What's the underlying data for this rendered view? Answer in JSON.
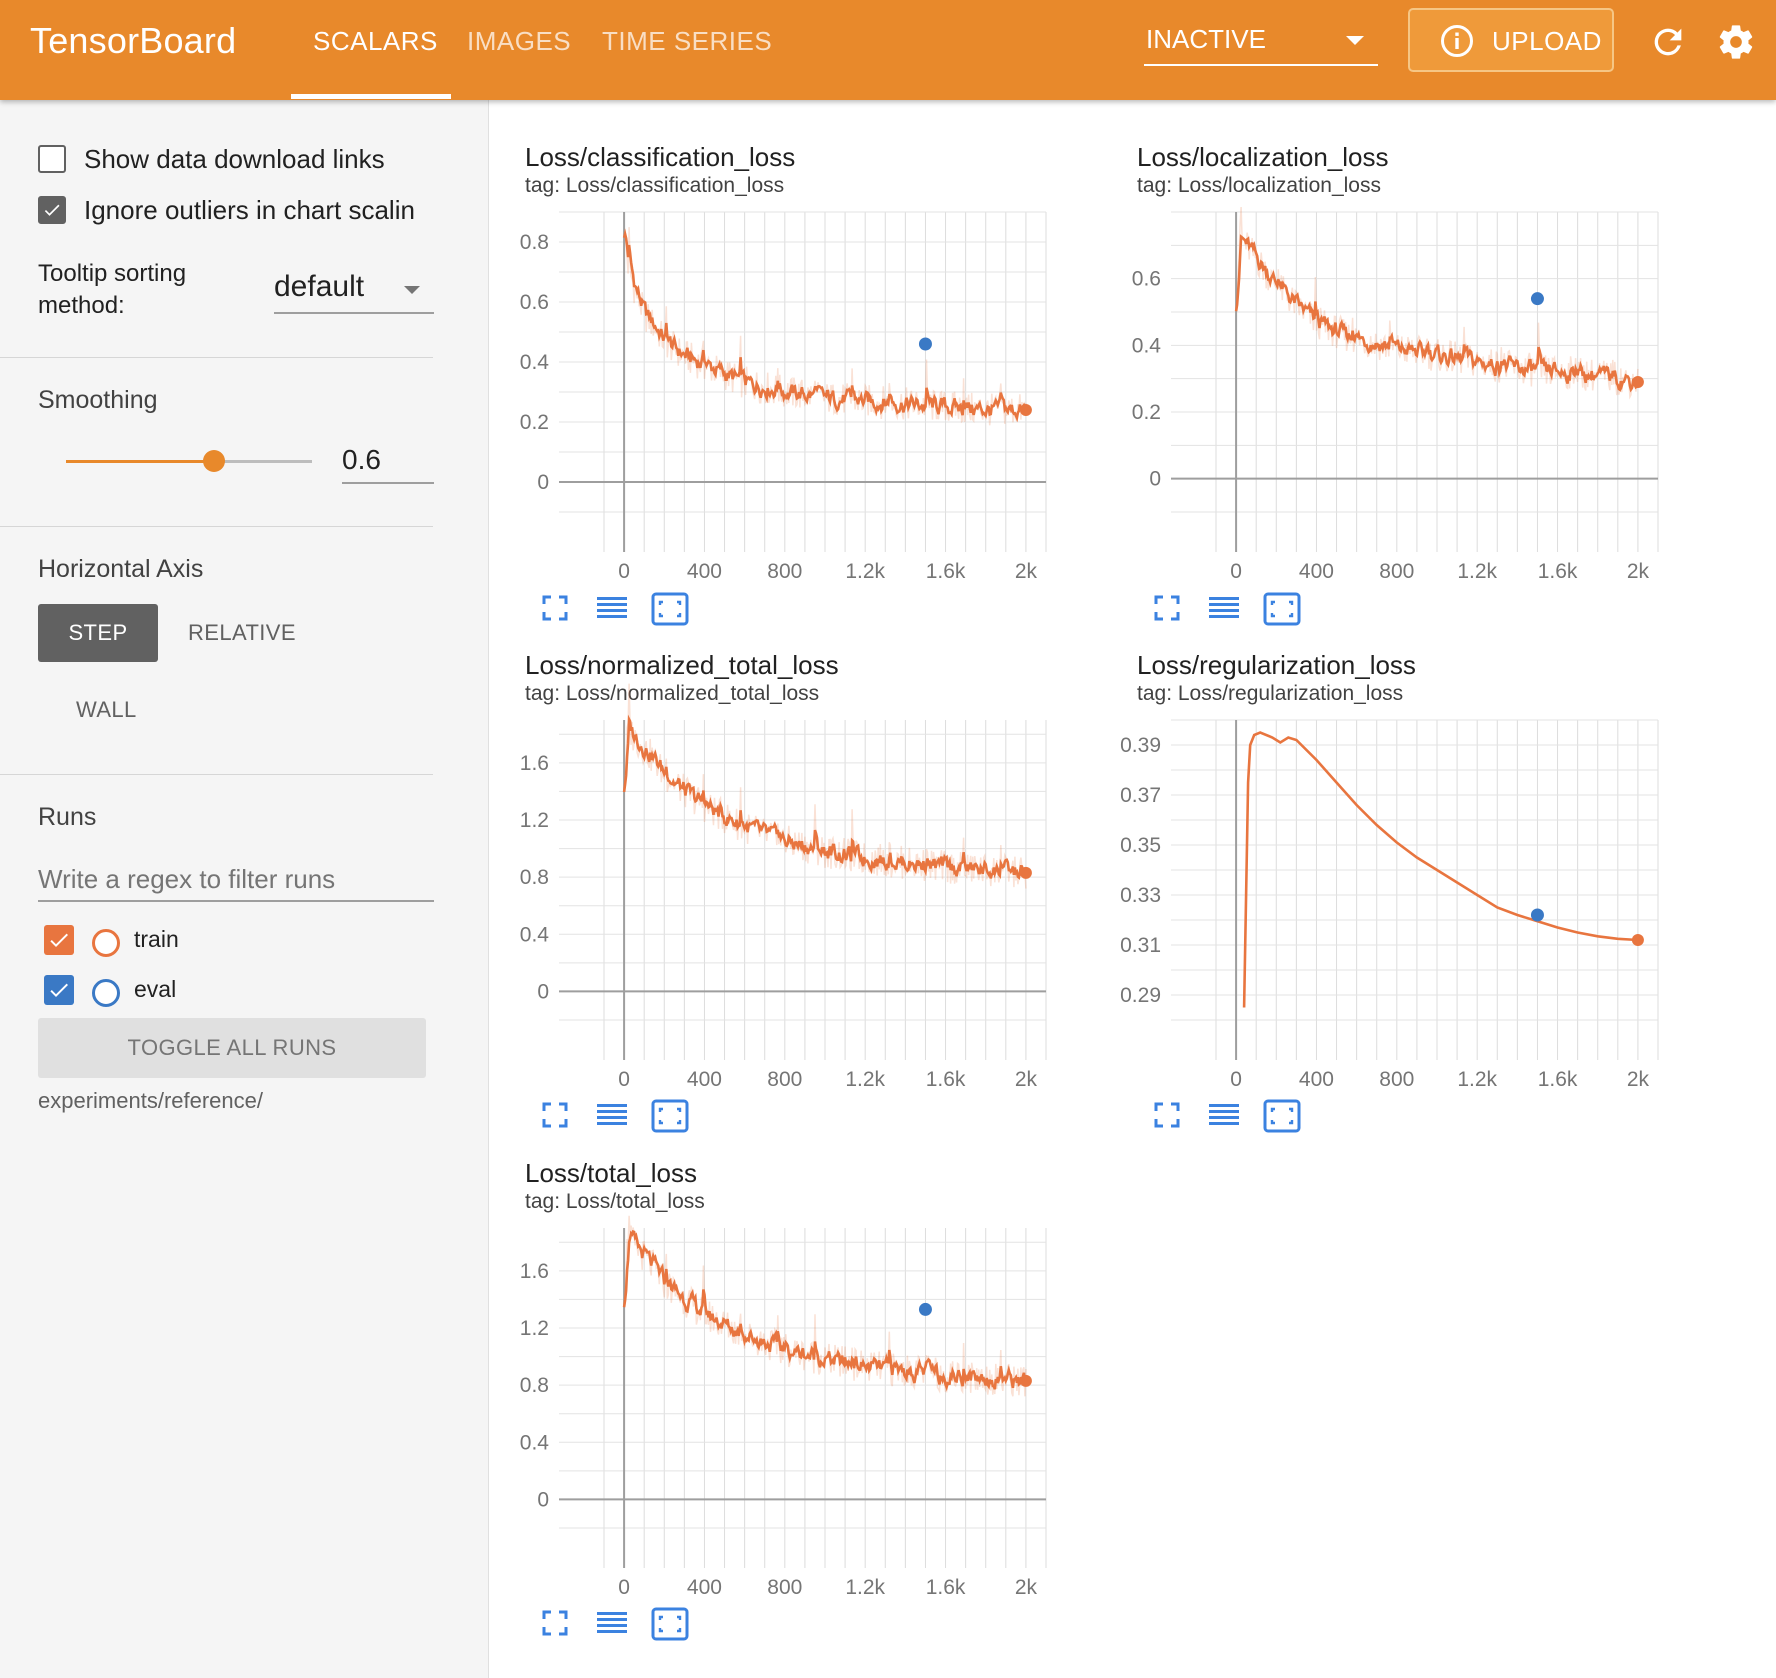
{
  "header": {
    "brand": "TensorBoard",
    "tabs": [
      {
        "label": "SCALARS",
        "active": true
      },
      {
        "label": "IMAGES",
        "active": false
      },
      {
        "label": "TIME SERIES",
        "active": false
      }
    ],
    "plugin_select": "INACTIVE",
    "upload_label": "UPLOAD",
    "bar_color": "#e8892b"
  },
  "sidebar": {
    "show_download_links": {
      "label": "Show data download links",
      "checked": false
    },
    "ignore_outliers": {
      "label": "Ignore outliers in chart scalin",
      "checked": true
    },
    "tooltip_sorting": {
      "label_line1": "Tooltip sorting",
      "label_line2": "method:",
      "value": "default"
    },
    "smoothing": {
      "label": "Smoothing",
      "value": "0.6"
    },
    "horizontal_axis": {
      "label": "Horizontal Axis",
      "options": [
        "STEP",
        "RELATIVE",
        "WALL"
      ],
      "selected": "STEP"
    },
    "runs": {
      "label": "Runs",
      "filter_placeholder": "Write a regex to filter runs",
      "items": [
        {
          "name": "train",
          "color": "#e8753f",
          "checked": true
        },
        {
          "name": "eval",
          "color": "#3a79c5",
          "checked": true
        }
      ],
      "toggle_label": "TOGGLE ALL RUNS",
      "logdir": "experiments/reference/"
    }
  },
  "cards": [
    {
      "title": "Loss/classification_loss",
      "tag": "tag: Loss/classification_loss"
    },
    {
      "title": "Loss/localization_loss",
      "tag": "tag: Loss/localization_loss"
    },
    {
      "title": "Loss/normalized_total_loss",
      "tag": "tag: Loss/normalized_total_loss"
    },
    {
      "title": "Loss/regularization_loss",
      "tag": "tag: Loss/regularization_loss"
    },
    {
      "title": "Loss/total_loss",
      "tag": "tag: Loss/total_loss"
    }
  ],
  "chart_data": [
    {
      "type": "line",
      "title": "Loss/classification_loss",
      "xlim": [
        -100,
        2100
      ],
      "ylim": [
        -0.1,
        0.9
      ],
      "xticks": [
        0,
        400,
        800,
        1200,
        1600,
        2000
      ],
      "xtick_labels": [
        "0",
        "400",
        "800",
        "1.2k",
        "1.6k",
        "2k"
      ],
      "yticks": [
        0,
        0.2,
        0.4,
        0.6,
        0.8
      ],
      "ytick_labels": [
        "0",
        "0.2",
        "0.4",
        "0.6",
        "0.8"
      ],
      "series": [
        {
          "name": "train",
          "color": "#e8753f",
          "x": [
            0,
            20,
            50,
            100,
            150,
            200,
            300,
            400,
            500,
            600,
            800,
            1000,
            1200,
            1400,
            1600,
            1800,
            1900,
            2000
          ],
          "y": [
            0.85,
            0.72,
            0.65,
            0.56,
            0.52,
            0.47,
            0.42,
            0.39,
            0.36,
            0.33,
            0.3,
            0.28,
            0.27,
            0.26,
            0.25,
            0.24,
            0.24,
            0.24
          ]
        },
        {
          "name": "eval",
          "color": "#3a79c5",
          "x": [
            1500
          ],
          "y": [
            0.46
          ]
        }
      ]
    },
    {
      "type": "line",
      "title": "Loss/localization_loss",
      "xlim": [
        -100,
        2100
      ],
      "ylim": [
        -0.1,
        0.8
      ],
      "xticks": [
        0,
        400,
        800,
        1200,
        1600,
        2000
      ],
      "xtick_labels": [
        "0",
        "400",
        "800",
        "1.2k",
        "1.6k",
        "2k"
      ],
      "yticks": [
        0,
        0.2,
        0.4,
        0.6
      ],
      "ytick_labels": [
        "0",
        "0.2",
        "0.4",
        "0.6"
      ],
      "series": [
        {
          "name": "train",
          "color": "#e8753f",
          "x": [
            0,
            20,
            50,
            100,
            200,
            300,
            400,
            500,
            600,
            800,
            1000,
            1200,
            1400,
            1600,
            1800,
            1900,
            2000
          ],
          "y": [
            0.55,
            0.72,
            0.7,
            0.66,
            0.58,
            0.52,
            0.47,
            0.44,
            0.42,
            0.39,
            0.37,
            0.35,
            0.33,
            0.32,
            0.31,
            0.3,
            0.29
          ]
        },
        {
          "name": "eval",
          "color": "#3a79c5",
          "x": [
            1500
          ],
          "y": [
            0.54
          ]
        }
      ]
    },
    {
      "type": "line",
      "title": "Loss/normalized_total_loss",
      "xlim": [
        -100,
        2100
      ],
      "ylim": [
        -0.2,
        1.9
      ],
      "xticks": [
        0,
        400,
        800,
        1200,
        1600,
        2000
      ],
      "xtick_labels": [
        "0",
        "400",
        "800",
        "1.2k",
        "1.6k",
        "2k"
      ],
      "yticks": [
        0,
        0.4,
        0.8,
        1.2,
        1.6
      ],
      "ytick_labels": [
        "0",
        "0.4",
        "0.8",
        "1.2",
        "1.6"
      ],
      "series": [
        {
          "name": "train",
          "color": "#e8753f",
          "x": [
            0,
            20,
            50,
            100,
            150,
            200,
            300,
            400,
            500,
            600,
            800,
            1000,
            1200,
            1400,
            1600,
            1800,
            1900,
            2000
          ],
          "y": [
            1.45,
            1.85,
            1.78,
            1.7,
            1.62,
            1.52,
            1.4,
            1.3,
            1.22,
            1.15,
            1.05,
            0.98,
            0.93,
            0.9,
            0.87,
            0.85,
            0.84,
            0.83
          ]
        }
      ]
    },
    {
      "type": "line",
      "title": "Loss/regularization_loss",
      "xlim": [
        -100,
        2100
      ],
      "ylim": [
        0.28,
        0.4
      ],
      "xticks": [
        0,
        400,
        800,
        1200,
        1600,
        2000
      ],
      "xtick_labels": [
        "0",
        "400",
        "800",
        "1.2k",
        "1.6k",
        "2k"
      ],
      "yticks": [
        0.29,
        0.31,
        0.33,
        0.35,
        0.37,
        0.39
      ],
      "ytick_labels": [
        "0.29",
        "0.31",
        "0.33",
        "0.35",
        "0.37",
        "0.39"
      ],
      "series": [
        {
          "name": "train",
          "color": "#e8753f",
          "x": [
            40,
            50,
            60,
            70,
            90,
            120,
            180,
            220,
            260,
            300,
            400,
            500,
            600,
            700,
            800,
            900,
            1000,
            1100,
            1200,
            1300,
            1400,
            1500,
            1600,
            1700,
            1800,
            1900,
            2000
          ],
          "y": [
            0.285,
            0.33,
            0.375,
            0.39,
            0.394,
            0.395,
            0.393,
            0.391,
            0.393,
            0.392,
            0.384,
            0.375,
            0.366,
            0.358,
            0.351,
            0.345,
            0.34,
            0.335,
            0.33,
            0.325,
            0.322,
            0.3195,
            0.317,
            0.315,
            0.3135,
            0.3125,
            0.312
          ]
        },
        {
          "name": "eval",
          "color": "#3a79c5",
          "x": [
            1500
          ],
          "y": [
            0.322
          ]
        }
      ]
    },
    {
      "type": "line",
      "title": "Loss/total_loss",
      "xlim": [
        -100,
        2100
      ],
      "ylim": [
        -0.2,
        1.9
      ],
      "xticks": [
        0,
        400,
        800,
        1200,
        1600,
        2000
      ],
      "xtick_labels": [
        "0",
        "400",
        "800",
        "1.2k",
        "1.6k",
        "2k"
      ],
      "yticks": [
        0,
        0.4,
        0.8,
        1.2,
        1.6
      ],
      "ytick_labels": [
        "0",
        "0.4",
        "0.8",
        "1.2",
        "1.6"
      ],
      "series": [
        {
          "name": "train",
          "color": "#e8753f",
          "x": [
            0,
            20,
            50,
            100,
            150,
            200,
            300,
            400,
            500,
            600,
            800,
            1000,
            1200,
            1400,
            1600,
            1800,
            1900,
            2000
          ],
          "y": [
            1.45,
            1.85,
            1.78,
            1.7,
            1.62,
            1.52,
            1.4,
            1.3,
            1.22,
            1.15,
            1.05,
            0.98,
            0.93,
            0.9,
            0.87,
            0.85,
            0.84,
            0.83
          ]
        },
        {
          "name": "eval",
          "color": "#3a79c5",
          "x": [
            1500
          ],
          "y": [
            1.33
          ]
        }
      ]
    }
  ]
}
